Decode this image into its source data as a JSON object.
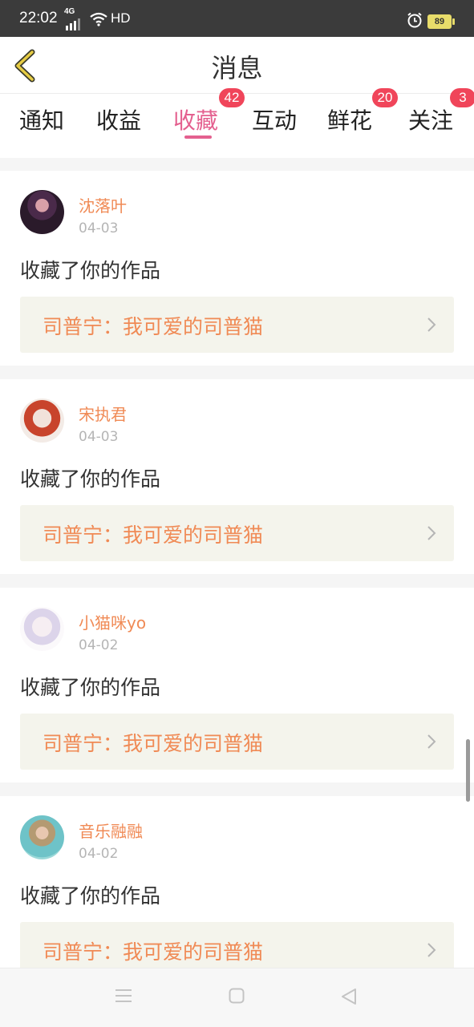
{
  "status_bar": {
    "time": "22:02",
    "network": "4G",
    "hd": "HD",
    "battery": "89"
  },
  "header": {
    "title": "消息",
    "back_icon": "chevron-left-icon",
    "accent_color": "#e0c030"
  },
  "tabs": [
    {
      "label": "通知"
    },
    {
      "label": "收益"
    },
    {
      "label": "收藏",
      "active": true,
      "badge": "42"
    },
    {
      "label": "互动"
    },
    {
      "label": "鲜花",
      "badge": "20"
    },
    {
      "label": "关注",
      "badge": "3"
    }
  ],
  "feed": [
    {
      "username": "沈落叶",
      "date": "04-03",
      "action": "收藏了你的作品",
      "work": "司普宁：我可爱的司普猫"
    },
    {
      "username": "宋执君",
      "date": "04-03",
      "action": "收藏了你的作品",
      "work": "司普宁：我可爱的司普猫"
    },
    {
      "username": "小猫咪yo",
      "date": "04-02",
      "action": "收藏了你的作品",
      "work": "司普宁：我可爱的司普猫"
    },
    {
      "username": "音乐融融",
      "date": "04-02",
      "action": "收藏了你的作品",
      "work": "司普宁：我可爱的司普猫"
    }
  ],
  "colors": {
    "active_tab": "#e4608f",
    "badge": "#f0455a",
    "username": "#f08a55",
    "work_bg": "#f4f4ec"
  },
  "nav": {
    "menu_icon": "menu-icon",
    "home_icon": "home-icon",
    "back_icon": "back-triangle-icon"
  }
}
